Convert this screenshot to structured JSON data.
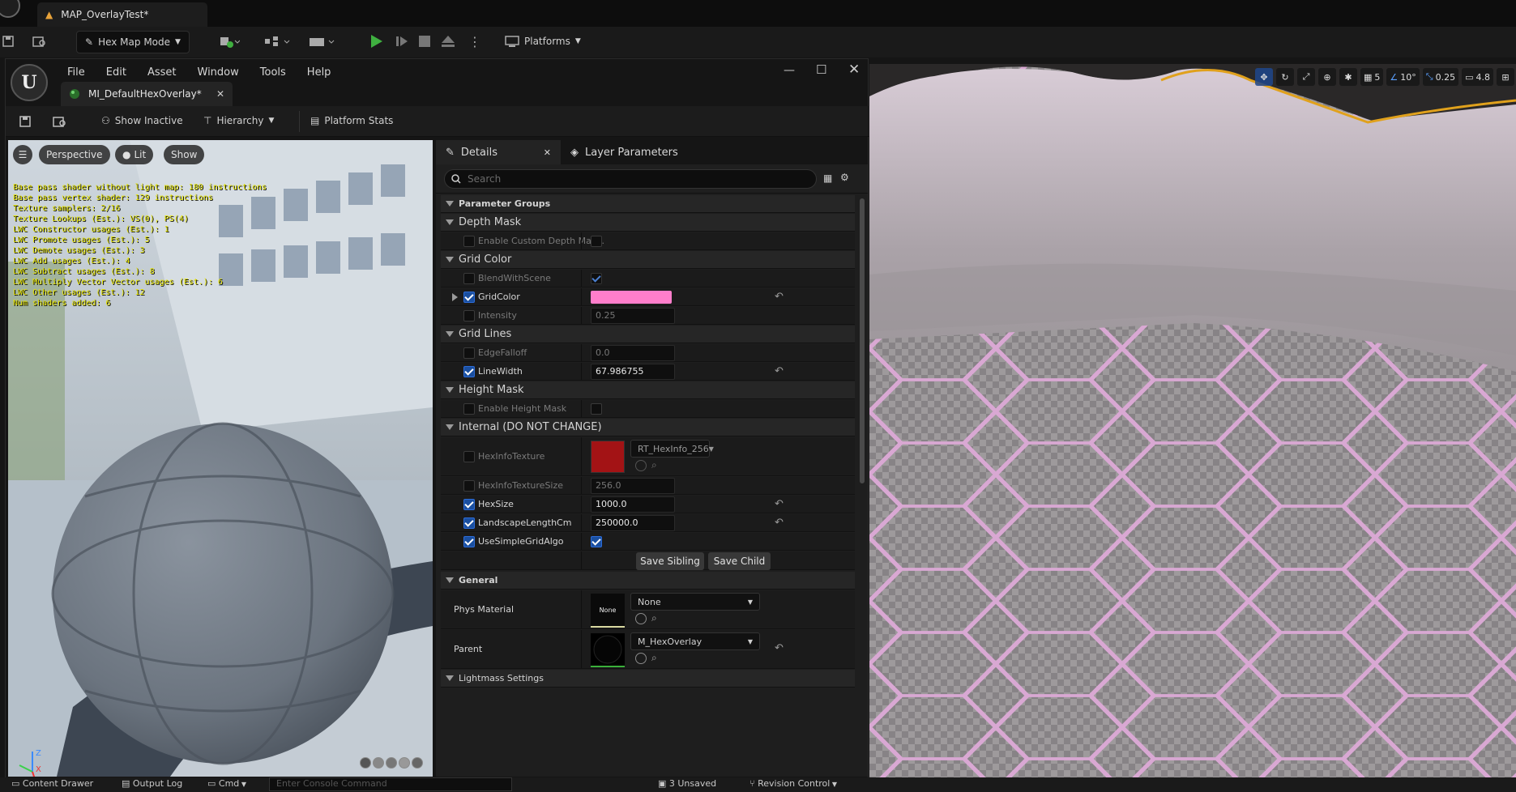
{
  "level_tab": {
    "title": "MAP_OverlayTest*"
  },
  "main_toolbar": {
    "mode_label": "Hex Map Mode",
    "platforms_label": "Platforms"
  },
  "editor": {
    "menus": [
      "File",
      "Edit",
      "Asset",
      "Window",
      "Tools",
      "Help"
    ],
    "asset_tab": "MI_DefaultHexOverlay*",
    "toolbar": {
      "show_inactive": "Show Inactive",
      "hierarchy": "Hierarchy",
      "platform_stats": "Platform Stats"
    }
  },
  "preview": {
    "perspective": "Perspective",
    "lit": "Lit",
    "show": "Show",
    "stats": [
      "Base pass shader without light map: 180 instructions",
      "Base pass vertex shader: 129 instructions",
      "Texture samplers: 2/16",
      "Texture Lookups (Est.): VS(0), PS(4)",
      "LWC Constructor usages (Est.): 1",
      "LWC Promote usages (Est.): 5",
      "LWC Demote usages (Est.): 3",
      "LWC Add usages (Est.): 4",
      "LWC Subtract usages (Est.): 8",
      "LWC Multiply Vector Vector usages (Est.): 6",
      "LWC Other usages (Est.): 12",
      "Num shaders added: 6"
    ],
    "axis_z": "Z",
    "axis_x": "X"
  },
  "details": {
    "tab_details": "Details",
    "tab_layers": "Layer Parameters",
    "search_placeholder": "Search",
    "parameter_groups": "Parameter Groups",
    "depth_mask": {
      "title": "Depth Mask",
      "enable_custom": "Enable Custom Depth Mas..."
    },
    "grid_color": {
      "title": "Grid Color",
      "blend": "BlendWithScene",
      "gridcolor": "GridColor",
      "intensity": "Intensity",
      "intensity_value": "0.25",
      "color_hex": "#ff7ecb"
    },
    "grid_lines": {
      "title": "Grid Lines",
      "edge": "EdgeFalloff",
      "edge_value": "0.0",
      "linewidth": "LineWidth",
      "linewidth_value": "67.986755"
    },
    "height_mask": {
      "title": "Height Mask",
      "enable": "Enable Height Mask"
    },
    "internal": {
      "title": "Internal (DO NOT CHANGE)",
      "hexinfotex": "HexInfoTexture",
      "hexinfotex_value": "RT_HexInfo_256",
      "texsize": "HexInfoTextureSize",
      "texsize_value": "256.0",
      "hexsize": "HexSize",
      "hexsize_value": "1000.0",
      "landscape": "LandscapeLengthCm",
      "landscape_value": "250000.0",
      "simplegrid": "UseSimpleGridAlgo",
      "swatch_hex": "#a31315"
    },
    "save_sibling": "Save Sibling",
    "save_child": "Save Child",
    "general": {
      "title": "General",
      "phys": "Phys Material",
      "phys_thumb": "None",
      "phys_value": "None",
      "parent": "Parent",
      "parent_value": "M_HexOverlay"
    },
    "lightmass": "Lightmass Settings"
  },
  "level_viewport": {
    "grid": "5",
    "angle": "10°",
    "scale": "0.25",
    "camera": "4.8"
  },
  "bottombar": {
    "content_drawer": "Content Drawer",
    "output_log": "Output Log",
    "cmd": "Cmd",
    "console_placeholder": "Enter Console Command",
    "unsaved": "3 Unsaved",
    "revision": "Revision Control"
  }
}
